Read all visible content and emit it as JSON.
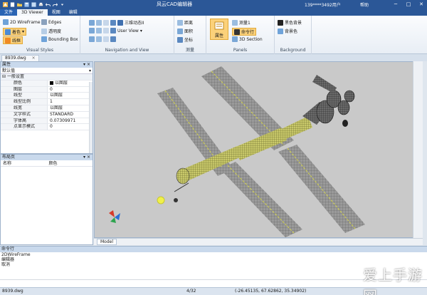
{
  "app": {
    "title": "风云CAD编辑器",
    "user": "139****3492用户",
    "help": "帮助"
  },
  "ribbon_tabs": [
    {
      "label": "文件"
    },
    {
      "label": "3D Viewer"
    },
    {
      "label": "视图"
    },
    {
      "label": "编辑"
    }
  ],
  "ribbon": {
    "visual_styles": {
      "items": [
        "2D WireFrame",
        "Edges",
        "着色",
        "透明度",
        "线框",
        "Bounding Box"
      ],
      "name": "Visual Styles"
    },
    "nav_view": {
      "user_view": "User View",
      "item1": "三维动态II",
      "name": "Navigation and View"
    },
    "measure": {
      "items": [
        "距离",
        "面积",
        "坐标"
      ],
      "name": "测量"
    },
    "panels": {
      "big_button": "属性",
      "items": [
        "测量1",
        "命令行",
        "3D Section"
      ],
      "name": "Panels"
    },
    "background": {
      "items": [
        "黑色背景",
        "背景色"
      ],
      "name": "Background"
    }
  },
  "file_tab": {
    "label": "8939.dwg",
    "close": "×"
  },
  "properties": {
    "title": "属性",
    "pin": "▾ ×",
    "combo": "默认值",
    "section": "一般设置",
    "rows": [
      {
        "key": "颜色",
        "value": "以图层"
      },
      {
        "key": "图层",
        "value": "0"
      },
      {
        "key": "线型",
        "value": "以图层"
      },
      {
        "key": "线型比例",
        "value": "1"
      },
      {
        "key": "线宽",
        "value": "以图层"
      },
      {
        "key": "文字样式",
        "value": "STANDARD"
      },
      {
        "key": "字体高",
        "value": "0.07309971"
      },
      {
        "key": "点显示模式",
        "value": "0"
      }
    ]
  },
  "layers_panel": {
    "title": "布局页",
    "pin": "▾ ×",
    "col1": "名称",
    "col2": "颜色"
  },
  "model_tab": {
    "label": "Model"
  },
  "command": {
    "title": "命令行",
    "lines": [
      "2DWireFrame",
      "编辑器",
      "取消"
    ]
  },
  "status": {
    "file": "8939.dwg",
    "page": "4/32",
    "coords": "(-26.45135, 67.62862, 35.34902)"
  },
  "watermark": "爱上手游网",
  "colors": {
    "titlebar": "#2b5797",
    "ribbon_active": "#fbd17a",
    "canvas": "#c9c9c9",
    "model_fill": "#c8c86a"
  }
}
